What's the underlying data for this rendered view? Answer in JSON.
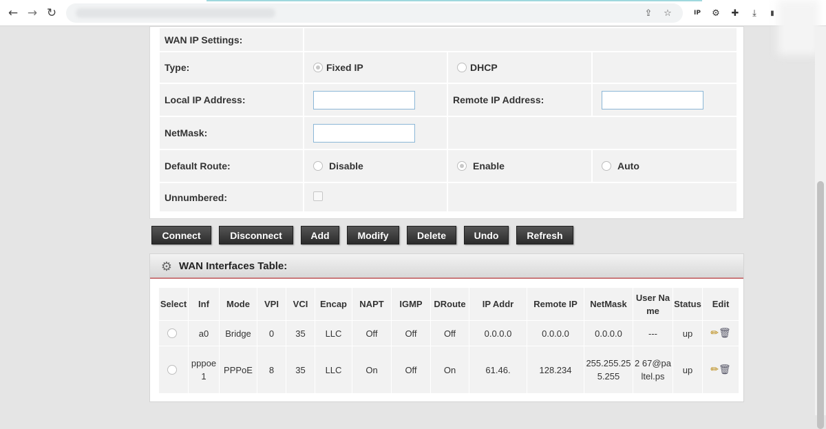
{
  "browser": {
    "back_icon": "←",
    "forward_icon": "→",
    "reload_icon": "↻",
    "share_icon": "⇪",
    "star_icon": "☆",
    "ext_ip": "IP",
    "ext_gear": "⚙",
    "ext_puzzle": "✚",
    "ext_download": "⤓",
    "ext_more": "▮"
  },
  "wan_ip": {
    "heading": "WAN IP Settings:",
    "type_label": "Type:",
    "fixed_ip_label": "Fixed IP",
    "dhcp_label": "DHCP",
    "type_selected": "Fixed IP",
    "local_ip_label": "Local IP Address:",
    "local_ip_value": "",
    "remote_ip_label": "Remote IP Address:",
    "remote_ip_value": "",
    "netmask_label": "NetMask:",
    "netmask_value": "",
    "default_route_label": "Default Route:",
    "route_disable_label": "Disable",
    "route_enable_label": "Enable",
    "route_auto_label": "Auto",
    "route_selected": "Enable",
    "unnumbered_label": "Unnumbered:",
    "unnumbered_checked": false
  },
  "actions": {
    "connect": "Connect",
    "disconnect": "Disconnect",
    "add": "Add",
    "modify": "Modify",
    "delete": "Delete",
    "undo": "Undo",
    "refresh": "Refresh"
  },
  "wan_table": {
    "title": "WAN Interfaces Table:",
    "headers": {
      "select": "Select",
      "inf": "Inf",
      "mode": "Mode",
      "vpi": "VPI",
      "vci": "VCI",
      "encap": "Encap",
      "napt": "NAPT",
      "igmp": "IGMP",
      "droute": "DRoute",
      "ip_addr": "IP Addr",
      "remote_ip": "Remote IP",
      "netmask": "NetMask",
      "user_name": "User Name",
      "status": "Status",
      "edit": "Edit"
    },
    "rows": [
      {
        "inf": "a0",
        "mode": "Bridge",
        "vpi": "0",
        "vci": "35",
        "encap": "LLC",
        "napt": "Off",
        "igmp": "Off",
        "droute": "Off",
        "ip_addr": "0.0.0.0",
        "remote_ip": "0.0.0.0",
        "netmask": "0.0.0.0",
        "user_name": "---",
        "status": "up"
      },
      {
        "inf": "pppoe1",
        "mode": "PPPoE",
        "vpi": "8",
        "vci": "35",
        "encap": "LLC",
        "napt": "On",
        "igmp": "Off",
        "droute": "On",
        "ip_addr": "61.46.",
        "remote_ip": "128.234",
        "netmask": "255.255.255.255",
        "user_name": "2 67@paltel.ps",
        "status": "up"
      }
    ],
    "edit_icon": "✏",
    "delete_icon": "🗑"
  },
  "colors": {
    "button_bg": "#333333",
    "header_rule": "#c9787a",
    "input_border": "#8ab6d6"
  }
}
